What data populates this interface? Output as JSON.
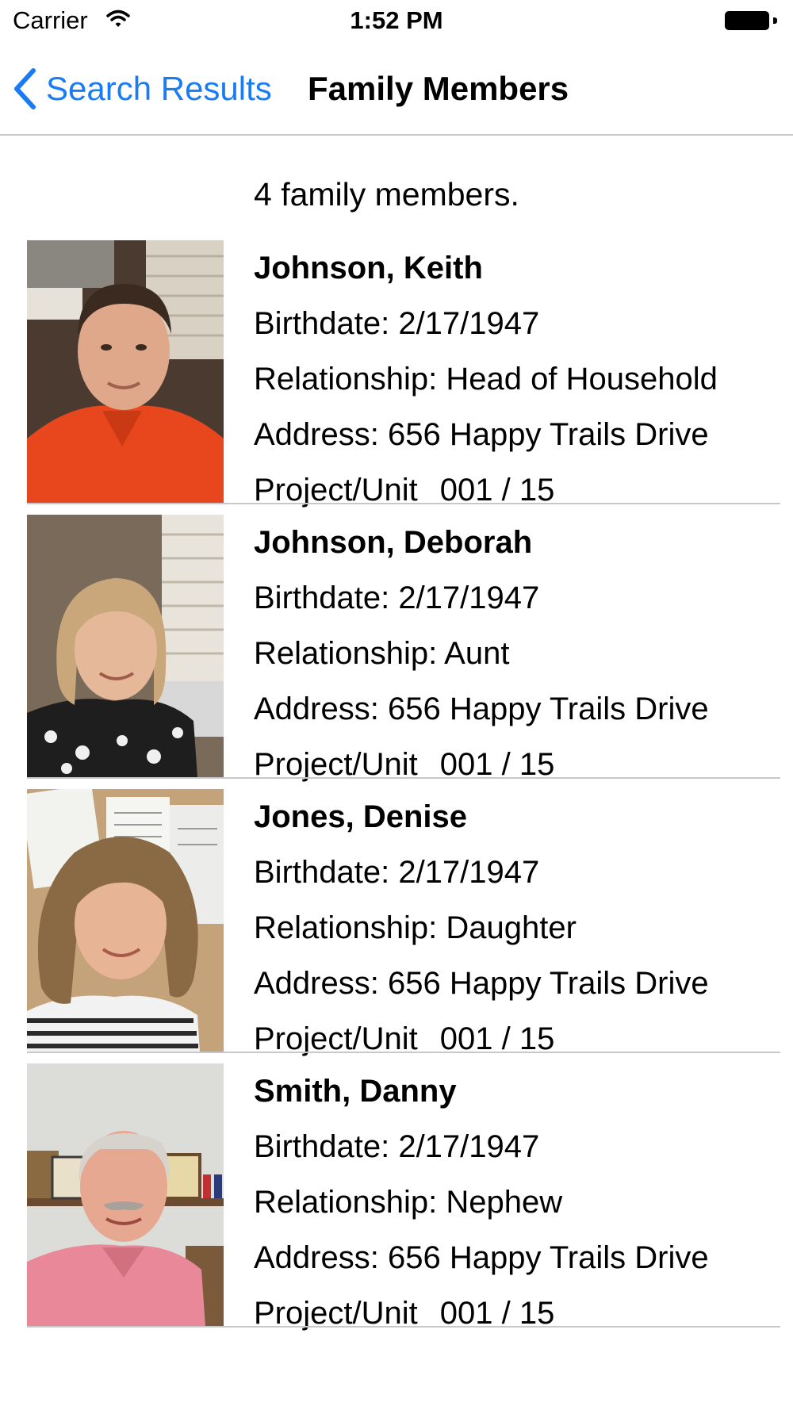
{
  "status_bar": {
    "carrier": "Carrier",
    "time": "1:52 PM"
  },
  "nav": {
    "back_label": "Search Results",
    "title": "Family Members",
    "accent_color": "#1a7cf5"
  },
  "summary": "4 family members.",
  "members": [
    {
      "name": "Johnson, Keith",
      "birthdate": "Birthdate: 2/17/1947",
      "relationship": "Relationship: Head of Household",
      "address": "Address: 656 Happy Trails Drive",
      "project_label": "Project/Unit",
      "project_value": "001 / 15"
    },
    {
      "name": "Johnson, Deborah",
      "birthdate": "Birthdate: 2/17/1947",
      "relationship": "Relationship: Aunt",
      "address": "Address: 656 Happy Trails Drive",
      "project_label": "Project/Unit",
      "project_value": "001 / 15"
    },
    {
      "name": "Jones, Denise",
      "birthdate": "Birthdate: 2/17/1947",
      "relationship": "Relationship: Daughter",
      "address": "Address: 656 Happy Trails Drive",
      "project_label": "Project/Unit",
      "project_value": "001 / 15"
    },
    {
      "name": "Smith, Danny",
      "birthdate": "Birthdate: 2/17/1947",
      "relationship": "Relationship: Nephew",
      "address": "Address: 656 Happy Trails Drive",
      "project_label": "Project/Unit",
      "project_value": "001 / 15"
    }
  ]
}
